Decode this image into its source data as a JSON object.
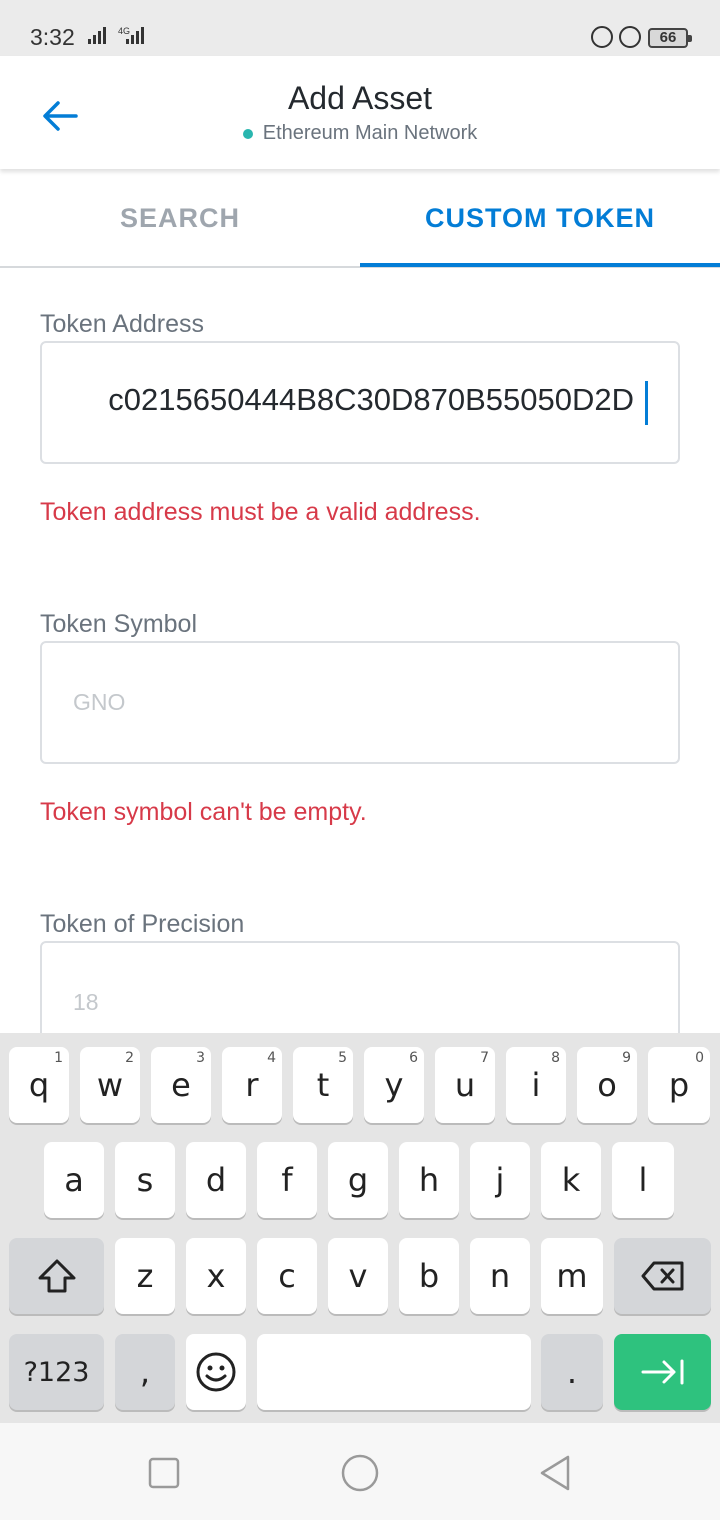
{
  "status_bar": {
    "time": "3:32",
    "network_label": "4G",
    "battery": "66"
  },
  "header": {
    "title": "Add Asset",
    "network": "Ethereum Main Network"
  },
  "tabs": [
    {
      "label": "SEARCH",
      "active": false
    },
    {
      "label": "CUSTOM TOKEN",
      "active": true
    }
  ],
  "form": {
    "address": {
      "label": "Token Address",
      "value": "c0215650444B8C30D870B55050D2D",
      "error": "Token address must be a valid address."
    },
    "symbol": {
      "label": "Token Symbol",
      "placeholder": "GNO",
      "error": "Token symbol can't be empty."
    },
    "precision": {
      "label": "Token of Precision",
      "placeholder": "18"
    }
  },
  "keyboard": {
    "row1": [
      {
        "k": "q",
        "n": "1"
      },
      {
        "k": "w",
        "n": "2"
      },
      {
        "k": "e",
        "n": "3"
      },
      {
        "k": "r",
        "n": "4"
      },
      {
        "k": "t",
        "n": "5"
      },
      {
        "k": "y",
        "n": "6"
      },
      {
        "k": "u",
        "n": "7"
      },
      {
        "k": "i",
        "n": "8"
      },
      {
        "k": "o",
        "n": "9"
      },
      {
        "k": "p",
        "n": "0"
      }
    ],
    "row2": [
      "a",
      "s",
      "d",
      "f",
      "g",
      "h",
      "j",
      "k",
      "l"
    ],
    "row3": [
      "z",
      "x",
      "c",
      "v",
      "b",
      "n",
      "m"
    ],
    "symbols_key": "?123",
    "comma_key": ",",
    "period_key": "."
  },
  "colors": {
    "accent": "#037dd6",
    "error": "#d73a49",
    "network_dot": "#29b6af",
    "enter_key": "#2ec27e"
  },
  "icons": {
    "back": "arrow-left-icon",
    "shift": "shift-icon",
    "backspace": "backspace-icon",
    "emoji": "emoji-icon",
    "enter": "enter-icon"
  }
}
